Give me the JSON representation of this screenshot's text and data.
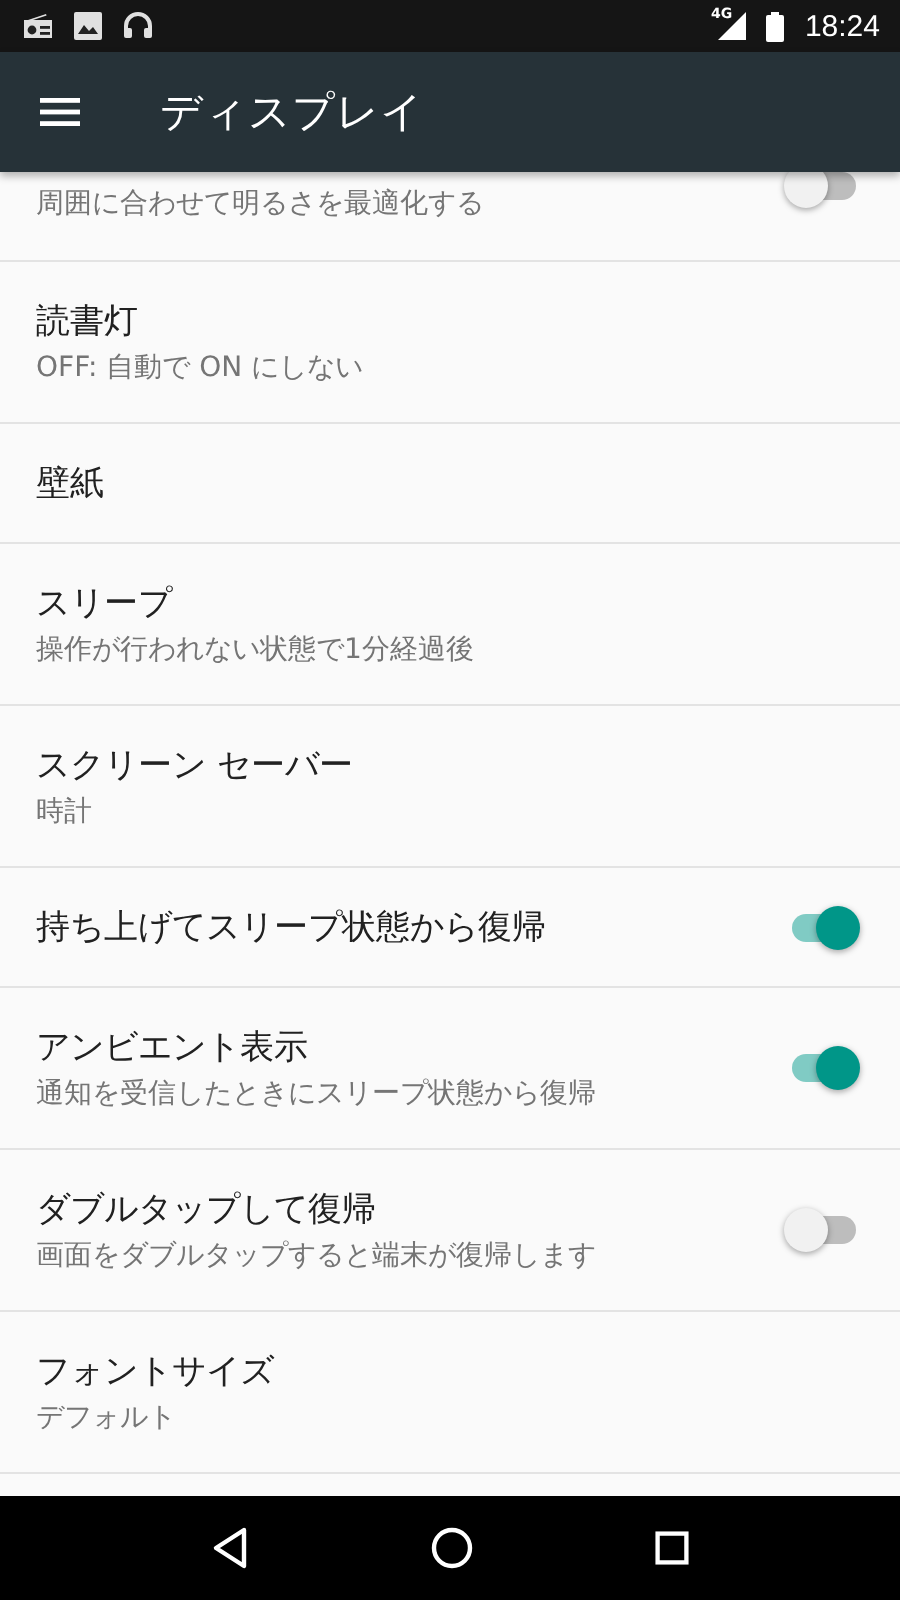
{
  "status_bar": {
    "network": "4G",
    "time": "18:24"
  },
  "app_bar": {
    "title": "ディスプレイ"
  },
  "settings": [
    {
      "kind": "toggle",
      "subtitle": "周囲に合わせて明るさを最適化する",
      "on": false
    },
    {
      "kind": "text",
      "title": "読書灯",
      "subtitle": "OFF: 自動で ON にしない"
    },
    {
      "kind": "text",
      "title": "壁紙"
    },
    {
      "kind": "text",
      "title": "スリープ",
      "subtitle": "操作が行われない状態で1分経過後"
    },
    {
      "kind": "text",
      "title": "スクリーン セーバー",
      "subtitle": "時計"
    },
    {
      "kind": "toggle",
      "title": "持ち上げてスリープ状態から復帰",
      "on": true
    },
    {
      "kind": "toggle",
      "title": "アンビエント表示",
      "subtitle": "通知を受信したときにスリープ状態から復帰",
      "on": true
    },
    {
      "kind": "toggle",
      "title": "ダブルタップして復帰",
      "subtitle": "画面をダブルタップすると端末が復帰します",
      "on": false
    },
    {
      "kind": "text",
      "title": "フォントサイズ",
      "subtitle": "デフォルト"
    }
  ]
}
